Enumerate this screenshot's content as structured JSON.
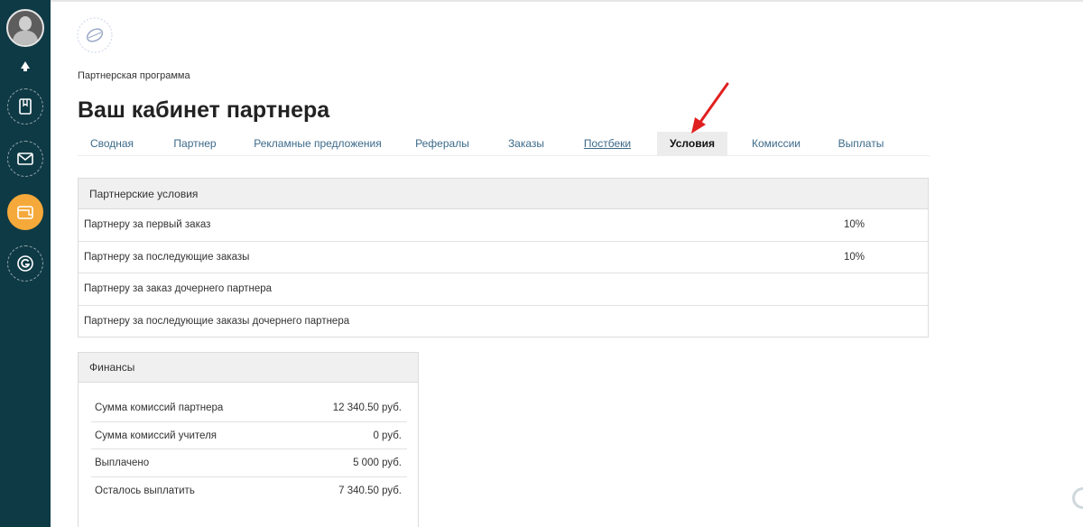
{
  "breadcrumb": "Партнерская программа",
  "page_title": "Ваш кабинет партнера",
  "tabs": [
    {
      "label": "Сводная"
    },
    {
      "label": "Партнер"
    },
    {
      "label": "Рекламные предложения"
    },
    {
      "label": "Рефералы"
    },
    {
      "label": "Заказы"
    },
    {
      "label": "Постбеки"
    },
    {
      "label": "Условия"
    },
    {
      "label": "Комиссии"
    },
    {
      "label": "Выплаты"
    }
  ],
  "active_tab": "Условия",
  "conditions": {
    "title": "Партнерские условия",
    "rows": [
      {
        "label": "Партнеру за первый заказ",
        "value": "10%"
      },
      {
        "label": "Партнеру за последующие заказы",
        "value": "10%"
      },
      {
        "label": "Партнеру за заказ дочернего партнера",
        "value": ""
      },
      {
        "label": "Партнеру за последующие заказы дочернего партнера",
        "value": ""
      }
    ]
  },
  "finance": {
    "title": "Финансы",
    "rows": [
      {
        "label": "Сумма комиссий партнера",
        "value": "12 340.50 руб."
      },
      {
        "label": "Сумма комиссий учителя",
        "value": "0 руб."
      },
      {
        "label": "Выплачено",
        "value": "5 000 руб."
      },
      {
        "label": "Осталось выплатить",
        "value": "7 340.50 руб."
      }
    ]
  },
  "sidebar": {
    "items": [
      {
        "icon": "avatar"
      },
      {
        "icon": "bell-icon"
      },
      {
        "icon": "bookmark-icon"
      },
      {
        "icon": "mail-icon"
      },
      {
        "icon": "wallet-icon",
        "active": true
      },
      {
        "icon": "getcourse-icon"
      }
    ]
  },
  "colors": {
    "sidebar_bg": "#0e3a45",
    "active_accent": "#f5a93a",
    "tab_link": "#3c6a8a",
    "annotation_arrow": "#e02020"
  }
}
